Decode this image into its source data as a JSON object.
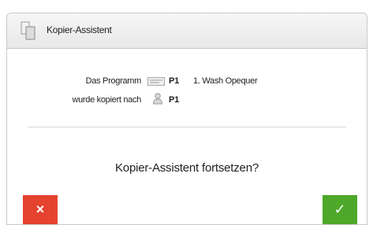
{
  "window": {
    "title": "Kopier-Assistent",
    "title_icon": "copy-icon"
  },
  "info": {
    "program_label": "Das Programm",
    "program_icon": "program-list-icon",
    "program_id": "P1",
    "program_name": "1. Wash Opequer",
    "copied_label": "wurde kopiert nach",
    "copied_icon": "user-icon",
    "copied_id": "P1"
  },
  "prompt": {
    "question": "Kopier-Assistent fortsetzen?"
  },
  "buttons": {
    "cancel_icon": "close-icon",
    "cancel_symbol": "×",
    "ok_icon": "check-icon",
    "ok_symbol": "✓"
  },
  "colors": {
    "cancel": "#e5422f",
    "ok": "#4ea82a"
  }
}
